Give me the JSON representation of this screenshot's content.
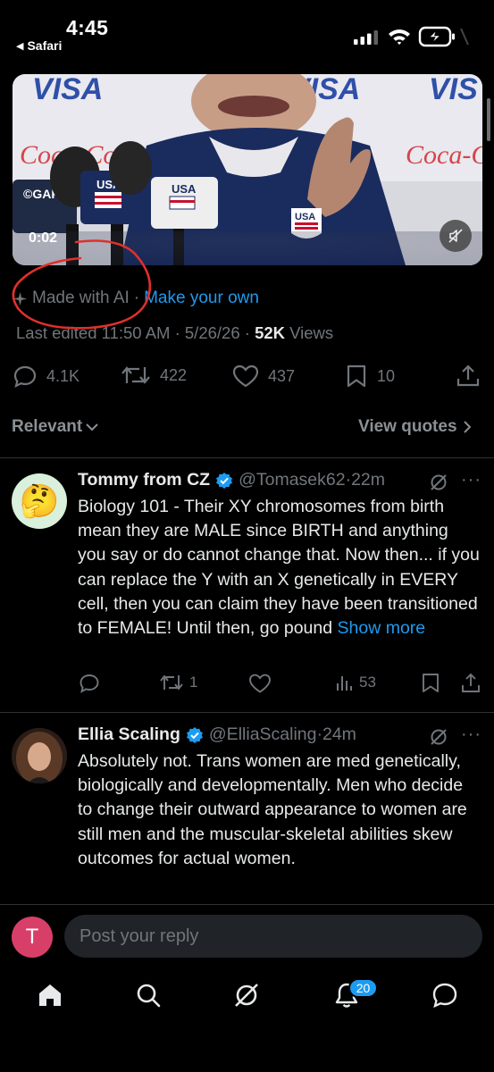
{
  "status_bar": {
    "time": "4:45",
    "back_app": "Safari",
    "signal_icon": "cellular-signal-icon",
    "wifi_icon": "wifi-icon",
    "battery_icon": "battery-charging-icon"
  },
  "video": {
    "elapsed": "0:02",
    "mute_icon": "speaker-muted-icon"
  },
  "ai_label": {
    "made_with": "Made with AI",
    "separator": "·",
    "make_your_own": "Make your own"
  },
  "post_meta": {
    "edited": "Last edited 11:50 AM · 5/26/26 · ",
    "views_count": "52K",
    "views_label": " Views"
  },
  "actions": {
    "replies": "4.1K",
    "reposts": "422",
    "likes": "437",
    "bookmarks": "10"
  },
  "sort": {
    "relevant": "Relevant",
    "view_quotes": "View quotes"
  },
  "replies": [
    {
      "name": "Tommy from CZ",
      "handle": "@Tomasek62",
      "time": "·22m",
      "text": "Biology 101 - Their XY chromosomes from birth mean they are MALE since BIRTH and anything you say or do cannot change that. Now then... if you can replace the Y with an X genetically in EVERY cell, then you can claim they have been transitioned to FEMALE!  Until then, go pound ",
      "show_more": "Show more",
      "reposts": "1",
      "views": "53",
      "avatar_emoji": "🤔"
    },
    {
      "name": "Ellia Scaling",
      "handle": "@ElliaScaling",
      "time": "·24m",
      "text": "Absolutely not. Trans women are med genetically, biologically and developmentally. Men who decide to change their outward appearance to women are still men and the muscular-skeletal abilities skew outcomes for actual women."
    }
  ],
  "composer": {
    "avatar_letter": "T",
    "placeholder": "Post your reply"
  },
  "tab_bar": {
    "notifications_badge": "20"
  },
  "colors": {
    "background": "#000000",
    "accent": "#1d9bf0",
    "muted_text": "#71767b",
    "annotation_red": "#e0302c"
  }
}
